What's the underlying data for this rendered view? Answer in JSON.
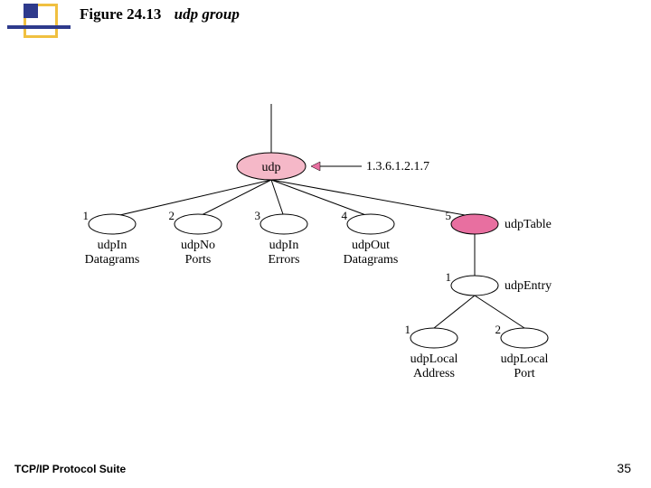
{
  "title": {
    "figure_number": "Figure 24.13",
    "caption": "udp group"
  },
  "footer": {
    "left": "TCP/IP Protocol Suite",
    "page_number": "35"
  },
  "chart_data": {
    "type": "tree",
    "root": {
      "name": "udp",
      "oid": "1.3.6.1.2.1.7"
    },
    "children": [
      {
        "index": "1",
        "name": [
          "udpIn",
          "Datagrams"
        ]
      },
      {
        "index": "2",
        "name": [
          "udpNo",
          "Ports"
        ]
      },
      {
        "index": "3",
        "name": [
          "udpIn",
          "Errors"
        ]
      },
      {
        "index": "4",
        "name": [
          "udpOut",
          "Datagrams"
        ]
      },
      {
        "index": "5",
        "name_right": "udpTable",
        "entry": {
          "index": "1",
          "name_right": "udpEntry",
          "children": [
            {
              "index": "1",
              "name": [
                "udpLocal",
                "Address"
              ]
            },
            {
              "index": "2",
              "name": [
                "udpLocal",
                "Port"
              ]
            }
          ]
        }
      }
    ]
  }
}
